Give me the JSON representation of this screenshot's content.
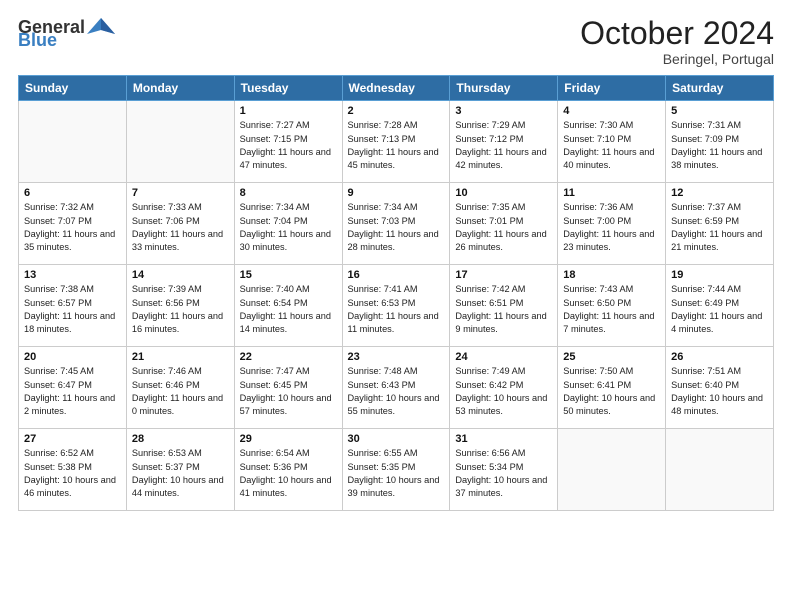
{
  "logo": {
    "general": "General",
    "blue": "Blue"
  },
  "header": {
    "month": "October 2024",
    "location": "Beringel, Portugal"
  },
  "weekdays": [
    "Sunday",
    "Monday",
    "Tuesday",
    "Wednesday",
    "Thursday",
    "Friday",
    "Saturday"
  ],
  "weeks": [
    [
      {
        "day": "",
        "info": ""
      },
      {
        "day": "",
        "info": ""
      },
      {
        "day": "1",
        "info": "Sunrise: 7:27 AM\nSunset: 7:15 PM\nDaylight: 11 hours and 47 minutes."
      },
      {
        "day": "2",
        "info": "Sunrise: 7:28 AM\nSunset: 7:13 PM\nDaylight: 11 hours and 45 minutes."
      },
      {
        "day": "3",
        "info": "Sunrise: 7:29 AM\nSunset: 7:12 PM\nDaylight: 11 hours and 42 minutes."
      },
      {
        "day": "4",
        "info": "Sunrise: 7:30 AM\nSunset: 7:10 PM\nDaylight: 11 hours and 40 minutes."
      },
      {
        "day": "5",
        "info": "Sunrise: 7:31 AM\nSunset: 7:09 PM\nDaylight: 11 hours and 38 minutes."
      }
    ],
    [
      {
        "day": "6",
        "info": "Sunrise: 7:32 AM\nSunset: 7:07 PM\nDaylight: 11 hours and 35 minutes."
      },
      {
        "day": "7",
        "info": "Sunrise: 7:33 AM\nSunset: 7:06 PM\nDaylight: 11 hours and 33 minutes."
      },
      {
        "day": "8",
        "info": "Sunrise: 7:34 AM\nSunset: 7:04 PM\nDaylight: 11 hours and 30 minutes."
      },
      {
        "day": "9",
        "info": "Sunrise: 7:34 AM\nSunset: 7:03 PM\nDaylight: 11 hours and 28 minutes."
      },
      {
        "day": "10",
        "info": "Sunrise: 7:35 AM\nSunset: 7:01 PM\nDaylight: 11 hours and 26 minutes."
      },
      {
        "day": "11",
        "info": "Sunrise: 7:36 AM\nSunset: 7:00 PM\nDaylight: 11 hours and 23 minutes."
      },
      {
        "day": "12",
        "info": "Sunrise: 7:37 AM\nSunset: 6:59 PM\nDaylight: 11 hours and 21 minutes."
      }
    ],
    [
      {
        "day": "13",
        "info": "Sunrise: 7:38 AM\nSunset: 6:57 PM\nDaylight: 11 hours and 18 minutes."
      },
      {
        "day": "14",
        "info": "Sunrise: 7:39 AM\nSunset: 6:56 PM\nDaylight: 11 hours and 16 minutes."
      },
      {
        "day": "15",
        "info": "Sunrise: 7:40 AM\nSunset: 6:54 PM\nDaylight: 11 hours and 14 minutes."
      },
      {
        "day": "16",
        "info": "Sunrise: 7:41 AM\nSunset: 6:53 PM\nDaylight: 11 hours and 11 minutes."
      },
      {
        "day": "17",
        "info": "Sunrise: 7:42 AM\nSunset: 6:51 PM\nDaylight: 11 hours and 9 minutes."
      },
      {
        "day": "18",
        "info": "Sunrise: 7:43 AM\nSunset: 6:50 PM\nDaylight: 11 hours and 7 minutes."
      },
      {
        "day": "19",
        "info": "Sunrise: 7:44 AM\nSunset: 6:49 PM\nDaylight: 11 hours and 4 minutes."
      }
    ],
    [
      {
        "day": "20",
        "info": "Sunrise: 7:45 AM\nSunset: 6:47 PM\nDaylight: 11 hours and 2 minutes."
      },
      {
        "day": "21",
        "info": "Sunrise: 7:46 AM\nSunset: 6:46 PM\nDaylight: 11 hours and 0 minutes."
      },
      {
        "day": "22",
        "info": "Sunrise: 7:47 AM\nSunset: 6:45 PM\nDaylight: 10 hours and 57 minutes."
      },
      {
        "day": "23",
        "info": "Sunrise: 7:48 AM\nSunset: 6:43 PM\nDaylight: 10 hours and 55 minutes."
      },
      {
        "day": "24",
        "info": "Sunrise: 7:49 AM\nSunset: 6:42 PM\nDaylight: 10 hours and 53 minutes."
      },
      {
        "day": "25",
        "info": "Sunrise: 7:50 AM\nSunset: 6:41 PM\nDaylight: 10 hours and 50 minutes."
      },
      {
        "day": "26",
        "info": "Sunrise: 7:51 AM\nSunset: 6:40 PM\nDaylight: 10 hours and 48 minutes."
      }
    ],
    [
      {
        "day": "27",
        "info": "Sunrise: 6:52 AM\nSunset: 5:38 PM\nDaylight: 10 hours and 46 minutes."
      },
      {
        "day": "28",
        "info": "Sunrise: 6:53 AM\nSunset: 5:37 PM\nDaylight: 10 hours and 44 minutes."
      },
      {
        "day": "29",
        "info": "Sunrise: 6:54 AM\nSunset: 5:36 PM\nDaylight: 10 hours and 41 minutes."
      },
      {
        "day": "30",
        "info": "Sunrise: 6:55 AM\nSunset: 5:35 PM\nDaylight: 10 hours and 39 minutes."
      },
      {
        "day": "31",
        "info": "Sunrise: 6:56 AM\nSunset: 5:34 PM\nDaylight: 10 hours and 37 minutes."
      },
      {
        "day": "",
        "info": ""
      },
      {
        "day": "",
        "info": ""
      }
    ]
  ]
}
